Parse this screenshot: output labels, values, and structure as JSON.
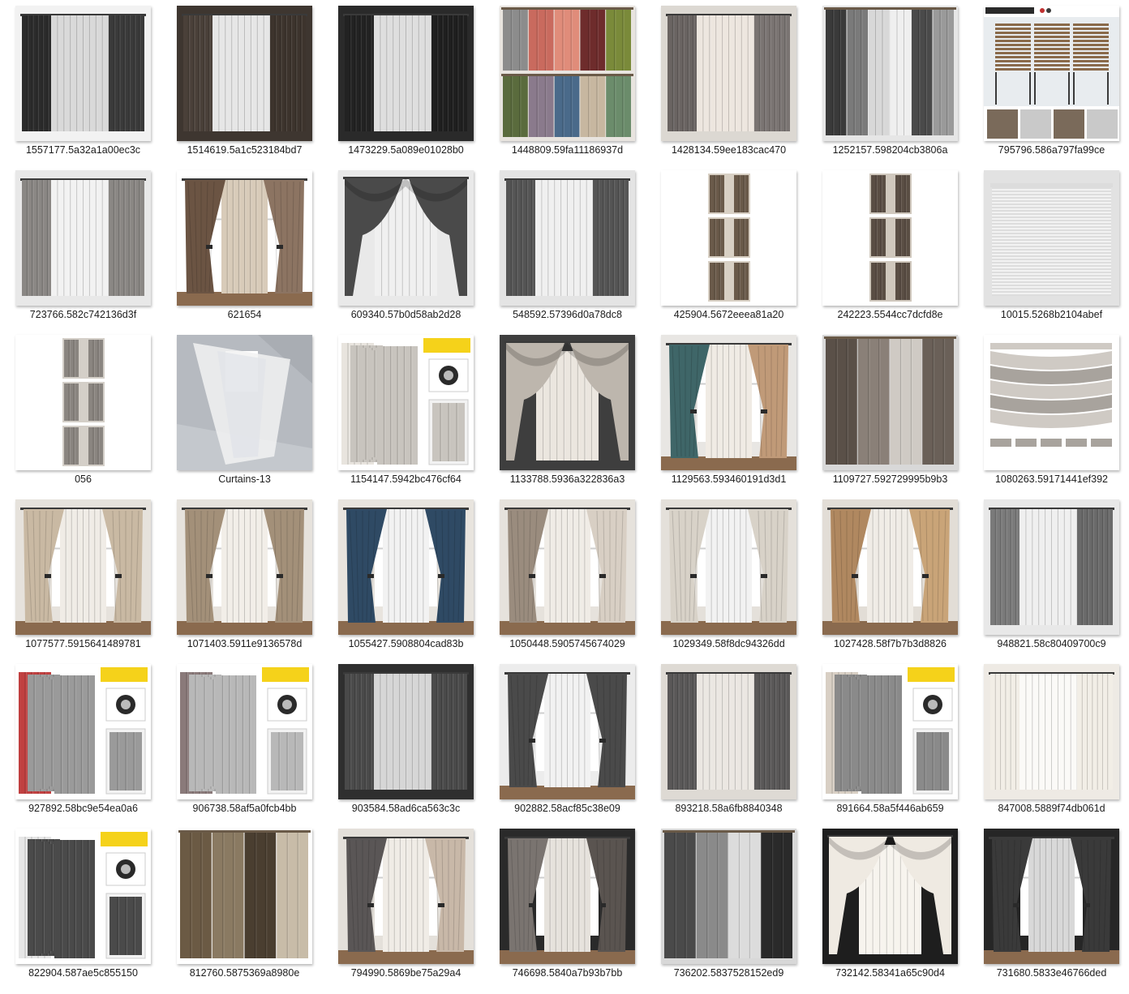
{
  "window": {
    "view": "large-icons"
  },
  "files": [
    {
      "name": "1557177.5a32a1a00ec3c",
      "thumb": {
        "style": "window",
        "bg": "#f2f2f2",
        "colors": [
          "#2b2b2b",
          "#d9d9d9",
          "#3a3a3a"
        ]
      }
    },
    {
      "name": "1514619.5a1c523184bd7",
      "thumb": {
        "style": "window",
        "bg": "#3e3630",
        "colors": [
          "#4a4039",
          "#e6e6e6",
          "#3d342d"
        ]
      }
    },
    {
      "name": "1473229.5a089e01028b0",
      "thumb": {
        "style": "window",
        "bg": "#2a2a2a",
        "colors": [
          "#222222",
          "#dedede",
          "#1f1f1f"
        ]
      }
    },
    {
      "name": "1448809.59fa11186937d",
      "thumb": {
        "style": "swatches",
        "bg": "#e8e4df",
        "colors": [
          "#8c8c8c",
          "#c96a5e",
          "#e08c7a",
          "#6e2c2c",
          "#7a8a3a",
          "#5a6b3d",
          "#8a7a8c",
          "#4a6a8a",
          "#c7b7a0",
          "#6b8c6b"
        ]
      }
    },
    {
      "name": "1428134.59ee183cac470",
      "thumb": {
        "style": "window",
        "bg": "#dcd8d2",
        "colors": [
          "#6a6462",
          "#ede6df",
          "#7a7472"
        ]
      }
    },
    {
      "name": "1252157.598204cb3806a",
      "thumb": {
        "style": "swatches",
        "bg": "#e6e6e6",
        "colors": [
          "#3a3a3a",
          "#7a7a7a",
          "#d8d8d8",
          "#efefef",
          "#4a4a4a",
          "#9a9a9a"
        ]
      }
    },
    {
      "name": "795796.586a797fa99ce",
      "thumb": {
        "style": "shutters",
        "bg": "#ffffff",
        "colors": [
          "#8a6a4a",
          "#3a3a3a",
          "#c9c9c9"
        ]
      }
    },
    {
      "name": "723766.582c742136d3f",
      "thumb": {
        "style": "window",
        "bg": "#e8e8e8",
        "colors": [
          "#8a8784",
          "#f2f2f2",
          "#8a8784"
        ]
      }
    },
    {
      "name": "621654",
      "thumb": {
        "style": "tieback",
        "bg": "#ffffff",
        "colors": [
          "#6b5443",
          "#d8cbb9",
          "#8c7462"
        ]
      }
    },
    {
      "name": "609340.57b0d58ab2d28",
      "thumb": {
        "style": "valance",
        "bg": "#e9e9e9",
        "colors": [
          "#4a4a4a",
          "#f0f0f0",
          "#4a4a4a"
        ]
      }
    },
    {
      "name": "548592.57396d0a78dc8",
      "thumb": {
        "style": "window",
        "bg": "#e4e4e4",
        "colors": [
          "#555555",
          "#f0f0f0",
          "#555555"
        ]
      }
    },
    {
      "name": "425904.5672eeea81a20",
      "thumb": {
        "style": "narrow",
        "bg": "#ffffff",
        "colors": [
          "#6a5a4a",
          "#d8d0c4"
        ]
      }
    },
    {
      "name": "242223.5544cc7dcfd8e",
      "thumb": {
        "style": "narrow",
        "bg": "#ffffff",
        "colors": [
          "#5a4e44",
          "#d0c8bd"
        ]
      }
    },
    {
      "name": "10015.5268b2104abef",
      "thumb": {
        "style": "blind",
        "bg": "#e2e2e2",
        "colors": [
          "#f2f2f2",
          "#c8c8c8"
        ]
      }
    },
    {
      "name": "056",
      "thumb": {
        "style": "narrow",
        "bg": "#ffffff",
        "colors": [
          "#8a8580",
          "#d4cfc8"
        ]
      }
    },
    {
      "name": "Curtains-13",
      "thumb": {
        "style": "sheer",
        "bg": "#a9adb3",
        "colors": [
          "#f2f2f2",
          "#dfe3e8"
        ]
      }
    },
    {
      "name": "1154147.5942bc476cf64",
      "thumb": {
        "style": "ikea",
        "bg": "#ffffff",
        "colors": [
          "#c8c4be",
          "#e8e4de",
          "#6a6a6a"
        ]
      }
    },
    {
      "name": "1133788.5936a322836a3",
      "thumb": {
        "style": "valance",
        "bg": "#3e3e3e",
        "colors": [
          "#bdb6ad",
          "#ebe6df",
          "#bdb6ad"
        ]
      }
    },
    {
      "name": "1129563.593460191d3d1",
      "thumb": {
        "style": "tieback",
        "bg": "#e8e6e3",
        "colors": [
          "#3f6668",
          "#f0ebe4",
          "#c09a78"
        ]
      }
    },
    {
      "name": "1109727.592729995b9b3",
      "thumb": {
        "style": "swatches",
        "bg": "#d8d8d8",
        "colors": [
          "#5a5048",
          "#8a8078",
          "#cfcac4",
          "#6a6058"
        ]
      }
    },
    {
      "name": "1080263.59171441ef392",
      "thumb": {
        "style": "roman",
        "bg": "#ffffff",
        "colors": [
          "#a8a39d",
          "#cfcac4"
        ]
      }
    },
    {
      "name": "1077577.5915641489781",
      "thumb": {
        "style": "tieback",
        "bg": "#e6e2dc",
        "colors": [
          "#c9b9a3",
          "#f0ece6",
          "#c9b9a3"
        ]
      }
    },
    {
      "name": "1071403.5911e9136578d",
      "thumb": {
        "style": "tieback",
        "bg": "#e6e2dc",
        "colors": [
          "#a39079",
          "#f2eee8",
          "#a39079"
        ]
      }
    },
    {
      "name": "1055427.5908804cad83b",
      "thumb": {
        "style": "tieback",
        "bg": "#e8e4de",
        "colors": [
          "#2f4a64",
          "#f2f2f2",
          "#2f4a64"
        ]
      }
    },
    {
      "name": "1050448.5905745674029",
      "thumb": {
        "style": "tieback",
        "bg": "#e6e2dc",
        "colors": [
          "#9a8c7e",
          "#f0ece6",
          "#d8cfc4"
        ]
      }
    },
    {
      "name": "1029349.58f8dc94326dd",
      "thumb": {
        "style": "tieback",
        "bg": "#e4e0da",
        "colors": [
          "#d8d2c8",
          "#f2f2f2",
          "#d8d2c8"
        ]
      }
    },
    {
      "name": "1027428.58f7b7b3d8826",
      "thumb": {
        "style": "tieback",
        "bg": "#e2ddd6",
        "colors": [
          "#b08860",
          "#f0ece6",
          "#c9a478"
        ]
      }
    },
    {
      "name": "948821.58c80409700c9",
      "thumb": {
        "style": "window",
        "bg": "#e8e8e8",
        "colors": [
          "#7a7a7a",
          "#efefef",
          "#6a6a6a"
        ]
      }
    },
    {
      "name": "927892.58bc9e54ea0a6",
      "thumb": {
        "style": "ikea",
        "bg": "#ffffff",
        "colors": [
          "#9a9a9a",
          "#c04040",
          "#3a4a6a"
        ]
      }
    },
    {
      "name": "906738.58af5a0fcb4bb",
      "thumb": {
        "style": "ikea",
        "bg": "#ffffff",
        "colors": [
          "#b8b8b8",
          "#8a7a7a",
          "#e0e0e0"
        ]
      }
    },
    {
      "name": "903584.58ad6ca563c3c",
      "thumb": {
        "style": "window",
        "bg": "#2f2f2f",
        "colors": [
          "#4a4a4a",
          "#d6d6d6",
          "#4a4a4a"
        ]
      }
    },
    {
      "name": "902882.58acf85c38e09",
      "thumb": {
        "style": "tieback",
        "bg": "#ececec",
        "colors": [
          "#4a4a4a",
          "#f2f2f2",
          "#4a4a4a"
        ]
      }
    },
    {
      "name": "893218.58a6fb8840348",
      "thumb": {
        "style": "window",
        "bg": "#dedad4",
        "colors": [
          "#5a5858",
          "#ebe7e2",
          "#5a5858"
        ]
      }
    },
    {
      "name": "891664.58a5f446ab659",
      "thumb": {
        "style": "ikea",
        "bg": "#ffffff",
        "colors": [
          "#8a8a8a",
          "#d8cfc4",
          "#6a6a6a"
        ]
      }
    },
    {
      "name": "847008.5889f74db061d",
      "thumb": {
        "style": "window",
        "bg": "#eeeae4",
        "colors": [
          "#f2eee6",
          "#fbfaf7",
          "#f2eee6"
        ]
      }
    },
    {
      "name": "822904.587ae5c855150",
      "thumb": {
        "style": "ikea",
        "bg": "#ffffff",
        "colors": [
          "#4a4a4a",
          "#e6e6e6",
          "#5a5a5a"
        ]
      }
    },
    {
      "name": "812760.5875369a8980e",
      "thumb": {
        "style": "swatches",
        "bg": "#ffffff",
        "colors": [
          "#6b5a44",
          "#8a7a62",
          "#4a3e30",
          "#c8bca8"
        ]
      }
    },
    {
      "name": "794990.5869be75a29a4",
      "thumb": {
        "style": "tieback",
        "bg": "#e4e0da",
        "colors": [
          "#5a5656",
          "#f0ece6",
          "#c8b8a8"
        ]
      }
    },
    {
      "name": "746698.5840a7b93b7bb",
      "thumb": {
        "style": "tieback",
        "bg": "#2a2a2a",
        "colors": [
          "#7a7470",
          "#e6e2dc",
          "#5a5450"
        ]
      }
    },
    {
      "name": "736202.5837528152ed9",
      "thumb": {
        "style": "swatches",
        "bg": "#d8d8d8",
        "colors": [
          "#4a4a4a",
          "#8a8a8a",
          "#dcdcdc",
          "#2a2a2a"
        ]
      }
    },
    {
      "name": "732142.58341a65c90d4",
      "thumb": {
        "style": "valance",
        "bg": "#1e1e1e",
        "colors": [
          "#efeae2",
          "#f7f4ee",
          "#efeae2"
        ]
      }
    },
    {
      "name": "731680.5833e46766ded",
      "thumb": {
        "style": "tieback",
        "bg": "#262626",
        "colors": [
          "#3a3a3a",
          "#d8d8d8",
          "#3a3a3a"
        ]
      }
    }
  ]
}
